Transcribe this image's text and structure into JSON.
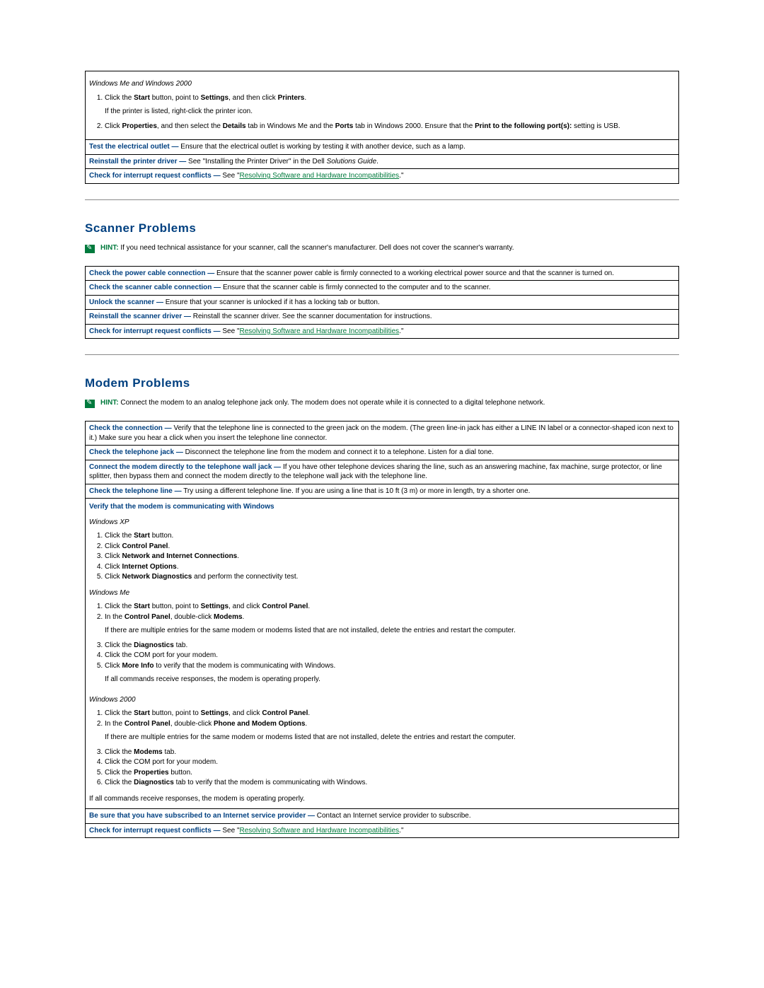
{
  "printer": {
    "os_label": "Windows Me and Windows 2000",
    "step1_pre": "Click the ",
    "step1_start": "Start",
    "step1_mid": " button, point to ",
    "step1_settings": "Settings",
    "step1_mid2": ", and then click ",
    "step1_printers": "Printers",
    "step1_end": ".",
    "step1_note": "If the printer is listed, right-click the printer icon.",
    "step2_pre": "Click ",
    "step2_properties": "Properties",
    "step2_mid1": ", and then select the ",
    "step2_details": "Details",
    "step2_mid2": " tab in Windows Me and the ",
    "step2_ports": "Ports",
    "step2_mid3": " tab in Windows 2000. Ensure that the ",
    "step2_printto": "Print to the following port(s):",
    "step2_end": " setting is USB.",
    "row_outlet_label": "Test the electrical outlet —",
    "row_outlet_text": " Ensure that the electrical outlet is working by testing it with another device, such as a lamp.",
    "row_reinstall_label": "Reinstall the printer driver —",
    "row_reinstall_text_pre": " See \"Installing the Printer Driver\" in the Dell ",
    "row_reinstall_italic": "Solutions Guide",
    "row_reinstall_text_end": ".",
    "row_irq_label": "Check for interrupt request conflicts —",
    "row_irq_pre": " See \"",
    "row_irq_link": "Resolving Software and Hardware Incompatibilities",
    "row_irq_end": ".\""
  },
  "scanner": {
    "heading": "Scanner Problems",
    "hint_label": "HINT:",
    "hint_text": " If you need technical assistance for your scanner, call the scanner's manufacturer. Dell does not cover the scanner's warranty.",
    "row1_label": "Check the power cable connection —",
    "row1_text": " Ensure that the scanner power cable is firmly connected to a working electrical power source and that the scanner is turned on.",
    "row2_label": "Check the scanner cable connection —",
    "row2_text": " Ensure that the scanner cable is firmly connected to the computer and to the scanner.",
    "row3_label": "Unlock the scanner —",
    "row3_text": " Ensure that your scanner is unlocked if it has a locking tab or button.",
    "row4_label": "Reinstall the scanner driver —",
    "row4_text": " Reinstall the scanner driver. See the scanner documentation for instructions.",
    "row5_label": "Check for interrupt request conflicts —",
    "row5_pre": " See \"",
    "row5_link": "Resolving Software and Hardware Incompatibilities",
    "row5_end": ".\""
  },
  "modem": {
    "heading": "Modem Problems",
    "hint_label": "HINT:",
    "hint_text": " Connect the modem to an analog telephone jack only. The modem does not operate while it is connected to a digital telephone network.",
    "row1_label": "Check the connection —",
    "row1_text": " Verify that the telephone line is connected to the green jack on the modem. (The green line-in jack has either a LINE IN label or a connector-shaped icon next to it.) Make sure you hear a click when you insert the telephone line connector.",
    "row2_label": "Check the telephone jack —",
    "row2_text": " Disconnect the telephone line from the modem and connect it to a telephone. Listen for a dial tone.",
    "row3_label": "Connect the modem directly to the telephone wall jack —",
    "row3_text": " If you have other telephone devices sharing the line, such as an answering machine, fax machine, surge protector, or line splitter, then bypass them and connect the modem directly to the telephone wall jack with the telephone line.",
    "row4_label": "Check the telephone line —",
    "row4_text": " Try using a different telephone line. If you are using a line that is 10 ft (3 m) or more in length, try a shorter one.",
    "row5_heading": "Verify that the modem is communicating with Windows",
    "xp_label": "Windows XP",
    "xp_s1_pre": "Click the ",
    "xp_s1_b": "Start",
    "xp_s1_end": " button.",
    "xp_s2_pre": "Click ",
    "xp_s2_b": "Control Panel",
    "xp_s2_end": ".",
    "xp_s3_pre": "Click ",
    "xp_s3_b": "Network and Internet Connections",
    "xp_s3_end": ".",
    "xp_s4_pre": "Click ",
    "xp_s4_b": "Internet Options",
    "xp_s4_end": ".",
    "xp_s5_pre": "Click ",
    "xp_s5_b": "Network Diagnostics",
    "xp_s5_end": " and perform the connectivity test.",
    "me_label": "Windows Me",
    "me_s1_pre": "Click the ",
    "me_s1_b1": "Start",
    "me_s1_mid": " button, point to ",
    "me_s1_b2": "Settings",
    "me_s1_mid2": ", and click ",
    "me_s1_b3": "Control Panel",
    "me_s1_end": ".",
    "me_s2_pre": "In the ",
    "me_s2_b1": "Control Panel",
    "me_s2_mid": ", double-click ",
    "me_s2_b2": "Modems",
    "me_s2_end": ".",
    "me_note1": "If there are multiple entries for the same modem or modems listed that are not installed, delete the entries and restart the computer.",
    "me_s3_pre": "Click the ",
    "me_s3_b": "Diagnostics",
    "me_s3_end": " tab.",
    "me_s4": "Click the COM port for your modem.",
    "me_s5_pre": "Click ",
    "me_s5_b": "More Info",
    "me_s5_end": " to verify that the modem is communicating with Windows.",
    "me_note2": "If all commands receive responses, the modem is operating properly.",
    "w2k_label": "Windows 2000",
    "w2k_s1_pre": "Click the ",
    "w2k_s1_b1": "Start",
    "w2k_s1_mid": " button, point to ",
    "w2k_s1_b2": "Settings",
    "w2k_s1_mid2": ", and click ",
    "w2k_s1_b3": "Control Panel",
    "w2k_s1_end": ".",
    "w2k_s2_pre": "In the ",
    "w2k_s2_b1": "Control Panel",
    "w2k_s2_mid": ", double-click ",
    "w2k_s2_b2": "Phone and Modem Options",
    "w2k_s2_end": ".",
    "w2k_note1": "If there are multiple entries for the same modem or modems listed that are not installed, delete the entries and restart the computer.",
    "w2k_s3_pre": "Click the ",
    "w2k_s3_b": "Modems",
    "w2k_s3_end": " tab.",
    "w2k_s4": "Click the COM port for your modem.",
    "w2k_s5_pre": "Click the ",
    "w2k_s5_b": "Properties",
    "w2k_s5_end": " button.",
    "w2k_s6_pre": "Click the ",
    "w2k_s6_b": "Diagnostics",
    "w2k_s6_end": " tab to verify that the modem is communicating with Windows.",
    "w2k_note2": "If all commands receive responses, the modem is operating properly.",
    "row6_label": "Be sure that you have subscribed to an Internet service provider —",
    "row6_text": " Contact an Internet service provider to subscribe.",
    "row7_label": "Check for interrupt request conflicts —",
    "row7_pre": " See \"",
    "row7_link": "Resolving Software and Hardware Incompatibilities",
    "row7_end": ".\""
  }
}
